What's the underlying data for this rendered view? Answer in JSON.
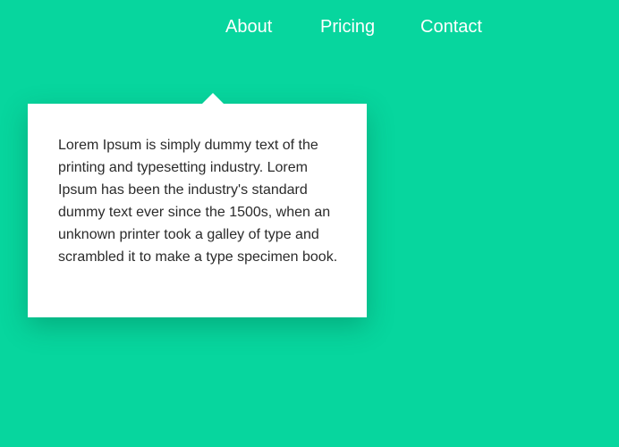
{
  "colors": {
    "background": "#07d69e",
    "nav_text": "#ffffff",
    "popover_background": "#ffffff",
    "popover_text": "#2b2b2b"
  },
  "nav": {
    "items": [
      {
        "label": "About"
      },
      {
        "label": "Pricing"
      },
      {
        "label": "Contact"
      }
    ]
  },
  "popover": {
    "text": "Lorem Ipsum is simply dummy text of the printing and typesetting industry. Lorem Ipsum has been the industry's standard dummy text ever since the 1500s, when an unknown printer took a galley of type and scrambled it to make a type specimen book."
  }
}
